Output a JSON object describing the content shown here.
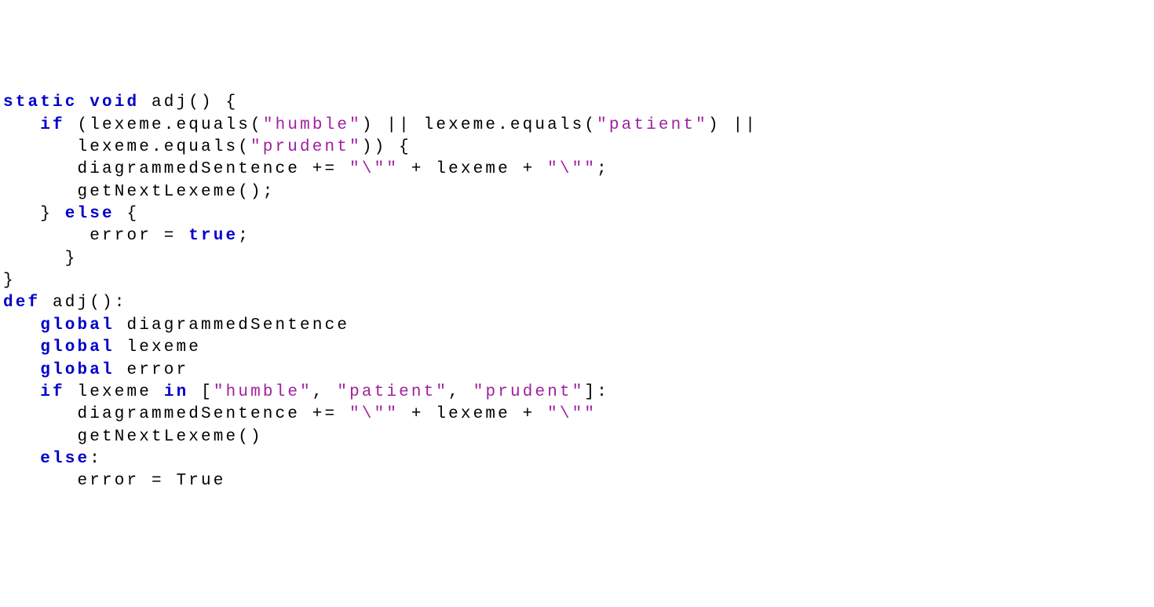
{
  "code": {
    "java": {
      "line1": {
        "kw1": "static",
        "kw2": "void",
        "rest": " adj() {"
      },
      "line2": {
        "indent": "   ",
        "kw": "if",
        "p1": " (lexeme.equals(",
        "s1": "\"humble\"",
        "p2": ") || lexeme.equals(",
        "s2": "\"patient\"",
        "p3": ") ||"
      },
      "line3": {
        "indent": "      lexeme.equals(",
        "s1": "\"prudent\"",
        "rest": ")) {"
      },
      "line4": {
        "indent": "      diagrammedSentence += ",
        "s1": "\"\\\"\"",
        "p1": " + lexeme + ",
        "s2": "\"\\\"\"",
        "p2": ";"
      },
      "line5": "      getNextLexeme();",
      "line6": {
        "p1": "   } ",
        "kw": "else",
        "p2": " {"
      },
      "line7": {
        "p1": "       error = ",
        "kw": "true",
        "p2": ";"
      },
      "line8": "     }",
      "line9": "}"
    },
    "python": {
      "line1": {
        "kw": "def",
        "rest": " adj():"
      },
      "line2": {
        "indent": "   ",
        "kw": "global",
        "rest": " diagrammedSentence"
      },
      "line3": {
        "indent": "   ",
        "kw": "global",
        "rest": " lexeme"
      },
      "line4": {
        "indent": "   ",
        "kw": "global",
        "rest": " error"
      },
      "line5": {
        "indent": "   ",
        "kw1": "if",
        "p1": " lexeme ",
        "kw2": "in",
        "p2": " [",
        "s1": "\"humble\"",
        "p3": ", ",
        "s2": "\"patient\"",
        "p4": ", ",
        "s3": "\"prudent\"",
        "p5": "]:"
      },
      "line6": {
        "indent": "      diagrammedSentence += ",
        "s1": "\"\\\"\"",
        "p1": " + lexeme + ",
        "s2": "\"\\\"\""
      },
      "line7": "      getNextLexeme()",
      "line8": {
        "indent": "   ",
        "kw": "else",
        "rest": ":"
      },
      "line9": "      error = True"
    }
  }
}
